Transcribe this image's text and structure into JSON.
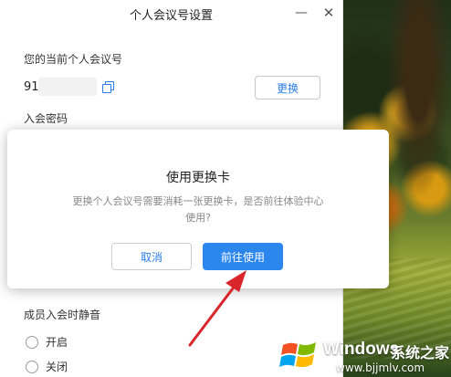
{
  "window": {
    "title": "个人会议号设置",
    "minimize_glyph": "—",
    "close_glyph": "✕"
  },
  "meeting": {
    "label": "您的当前个人会议号",
    "number_prefix": "91",
    "change_label": "更换",
    "password_label": "入会密码"
  },
  "mute": {
    "label": "成员入会时静音",
    "options": [
      "开启",
      "关闭"
    ]
  },
  "modal": {
    "title": "使用更换卡",
    "message_line1": "更换个人会议号需要消耗一张更换卡，是否前往体验中心",
    "message_line2": "使用?",
    "cancel_label": "取消",
    "confirm_label": "前往使用"
  },
  "watermark": {
    "brand": "Windows",
    "site_name": "系统之家",
    "url": "www.bjjmlv.com"
  },
  "colors": {
    "accent": "#2b86ee",
    "arrow": "#d9262b"
  },
  "icons": [
    "copy-icon",
    "minimize-icon",
    "close-icon",
    "windows-logo-icon",
    "arrow-pointer"
  ]
}
